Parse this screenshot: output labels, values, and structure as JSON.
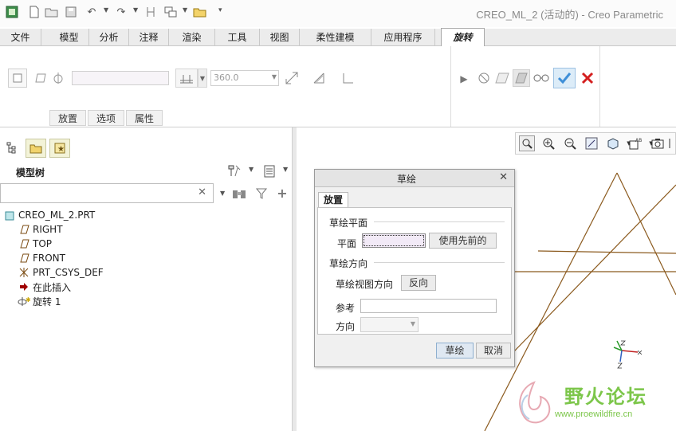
{
  "app": {
    "title": "CREO_ML_2 (活动的) - Creo Parametric"
  },
  "ribbon_tabs": [
    {
      "label": "文件"
    },
    {
      "label": "模型"
    },
    {
      "label": "分析"
    },
    {
      "label": "注释"
    },
    {
      "label": "渲染"
    },
    {
      "label": "工具"
    },
    {
      "label": "视图"
    },
    {
      "label": "柔性建模"
    },
    {
      "label": "应用程序"
    },
    {
      "label": "旋转"
    }
  ],
  "ribbon": {
    "angle_value": "360.0",
    "subtabs": [
      {
        "label": "放置"
      },
      {
        "label": "选项"
      },
      {
        "label": "属性"
      }
    ]
  },
  "navigator": {
    "title": "模型树",
    "search_value": "",
    "items": [
      {
        "label": "CREO_ML_2.PRT"
      },
      {
        "label": "RIGHT"
      },
      {
        "label": "TOP"
      },
      {
        "label": "FRONT"
      },
      {
        "label": "PRT_CSYS_DEF"
      },
      {
        "label": "在此插入"
      },
      {
        "label": "旋转 1"
      }
    ]
  },
  "dialog": {
    "title": "草绘",
    "tab": "放置",
    "group_plane": "草绘平面",
    "plane_label": "平面",
    "plane_value": "",
    "use_previous": "使用先前的",
    "group_orientation": "草绘方向",
    "view_dir_label": "草绘视图方向",
    "flip": "反向",
    "ref_label": "参考",
    "ref_value": "",
    "dir_label": "方向",
    "dir_value": "",
    "ok": "草绘",
    "cancel": "取消"
  },
  "watermark": {
    "text": "野火论坛",
    "url": "www.proewildfire.cn"
  },
  "colors": {
    "sketch_lines": "#8b5a1e",
    "confirm_green": "#3f8fd8",
    "cancel_red": "#d42020",
    "insert_arrow": "#a00000",
    "watermark_green": "#7cc64a"
  }
}
